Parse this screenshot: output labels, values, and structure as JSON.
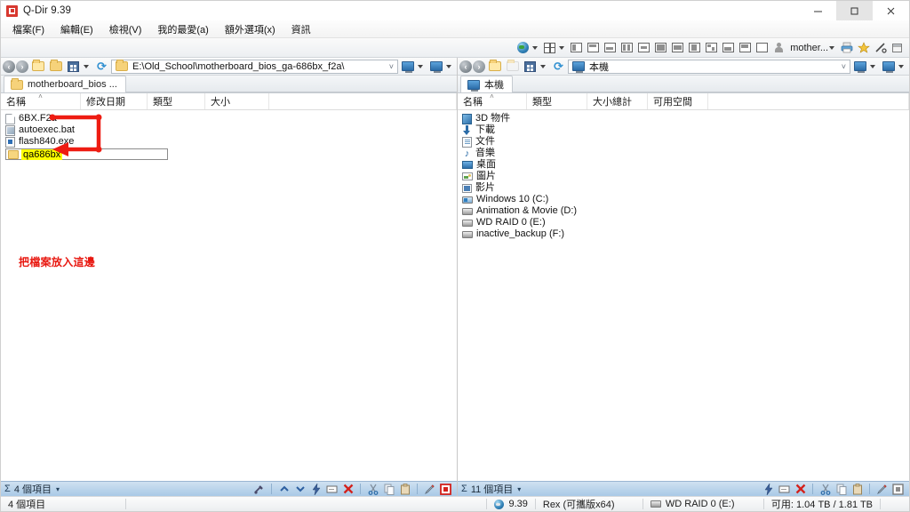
{
  "window": {
    "title": "Q-Dir 9.39",
    "app_icon": "qdir-icon",
    "minimize_label": "─",
    "maximize_label": "□",
    "close_label": "✕"
  },
  "menubar": {
    "items": [
      {
        "label": "檔案(F)",
        "name": "menu-file"
      },
      {
        "label": "編輯(E)",
        "name": "menu-edit"
      },
      {
        "label": "檢視(V)",
        "name": "menu-view"
      },
      {
        "label": "我的最愛(a)",
        "name": "menu-favorites"
      },
      {
        "label": "額外選項(x)",
        "name": "menu-extra-options"
      },
      {
        "label": "資訊",
        "name": "menu-info"
      }
    ]
  },
  "toolbar": {
    "globe_icon": "globe-icon",
    "view_layout_icon": "view-layout-icon",
    "pane_layout_count": 12,
    "user_label": "mother...",
    "user_icon": "person-icon",
    "print_icon": "printer-icon",
    "favorite_icon": "star-icon",
    "tools_icon": "tools-icon",
    "window_icon": "window-icon"
  },
  "left_pane": {
    "address": {
      "back_icon": "back-arrow-icon",
      "forward_icon": "forward-arrow-icon",
      "up_icon": "up-folder-icon",
      "open_icon": "open-folder-icon",
      "grid_icon": "grid-view-icon",
      "refresh_icon": "refresh-icon",
      "path": "E:\\Old_School\\motherboard_bios_ga-686bx_f2a\\",
      "dropdown_icon": "chevron-down-icon",
      "view1_icon": "monitor-icon",
      "view2_icon": "monitor-icon"
    },
    "tab": {
      "label": "motherboard_bios ...",
      "icon": "folder-icon"
    },
    "columns": [
      {
        "label": "名稱",
        "sort": "˄",
        "width": 90
      },
      {
        "label": "修改日期",
        "width": 75
      },
      {
        "label": "類型",
        "width": 65
      },
      {
        "label": "大小",
        "width": 72
      }
    ],
    "files": [
      {
        "name": "6BX.F2a",
        "icon": "generic-file-icon",
        "type": "file"
      },
      {
        "name": "autoexec.bat",
        "icon": "batch-file-icon",
        "type": "bat"
      },
      {
        "name": "flash840.exe",
        "icon": "executable-file-icon",
        "type": "exe"
      }
    ],
    "edit_row": {
      "value": "qa686bx",
      "icon": "folder-icon",
      "highlighted": true
    },
    "annotation": {
      "text": "把檔案放入這邊",
      "color": "#e8170f"
    },
    "status": {
      "sigma": "Σ",
      "count_label": "4 個項目",
      "caret": "▾",
      "icons": [
        "tools-icon",
        "move-up-icon",
        "move-down-icon",
        "flash-icon",
        "rename-icon",
        "delete-icon",
        "cut-icon",
        "copy-icon",
        "paste-icon",
        "edit-icon",
        "stop-icon"
      ]
    }
  },
  "right_pane": {
    "address": {
      "back_icon": "back-arrow-icon",
      "forward_icon": "forward-arrow-icon",
      "up_icon": "up-folder-icon",
      "open_icon": "open-folder-icon",
      "grid_icon": "grid-view-icon",
      "refresh_icon": "refresh-icon",
      "path": "本機",
      "dropdown_icon": "chevron-down-icon",
      "view1_icon": "monitor-icon",
      "view2_icon": "monitor-icon"
    },
    "tab": {
      "label": "本機",
      "icon": "this-pc-icon"
    },
    "columns": [
      {
        "label": "名稱",
        "sort": "˄",
        "width": 78
      },
      {
        "label": "類型",
        "width": 68
      },
      {
        "label": "大小總計",
        "width": 68
      },
      {
        "label": "可用空間",
        "width": 68
      }
    ],
    "items": [
      {
        "name": "3D 物件",
        "icon": "3d-objects-icon"
      },
      {
        "name": "下載",
        "icon": "downloads-icon"
      },
      {
        "name": "文件",
        "icon": "documents-icon"
      },
      {
        "name": "音樂",
        "icon": "music-icon"
      },
      {
        "name": "桌面",
        "icon": "desktop-icon"
      },
      {
        "name": "圖片",
        "icon": "pictures-icon"
      },
      {
        "name": "影片",
        "icon": "videos-icon"
      },
      {
        "name": "Windows 10 (C:)",
        "icon": "system-drive-icon"
      },
      {
        "name": "Animation & Movie (D:)",
        "icon": "drive-icon"
      },
      {
        "name": "WD RAID 0 (E:)",
        "icon": "drive-icon"
      },
      {
        "name": "inactive_backup (F:)",
        "icon": "drive-icon"
      }
    ],
    "status": {
      "sigma": "Σ",
      "count_label": "11 個項目",
      "caret": "▾",
      "icons": [
        "flash-icon",
        "rename-icon",
        "delete-icon",
        "cut-icon",
        "copy-icon",
        "paste-icon",
        "edit-icon",
        "stop-icon"
      ]
    }
  },
  "statusbar": {
    "selection_label": "4 個項目",
    "version_icon": "qdir-icon",
    "version": "9.39",
    "edition": "Rex (可攜版x64)",
    "drive_icon": "drive-icon",
    "drive": "WD RAID 0 (E:)",
    "free_space": "可用: 1.04 TB / 1.81 TB"
  }
}
